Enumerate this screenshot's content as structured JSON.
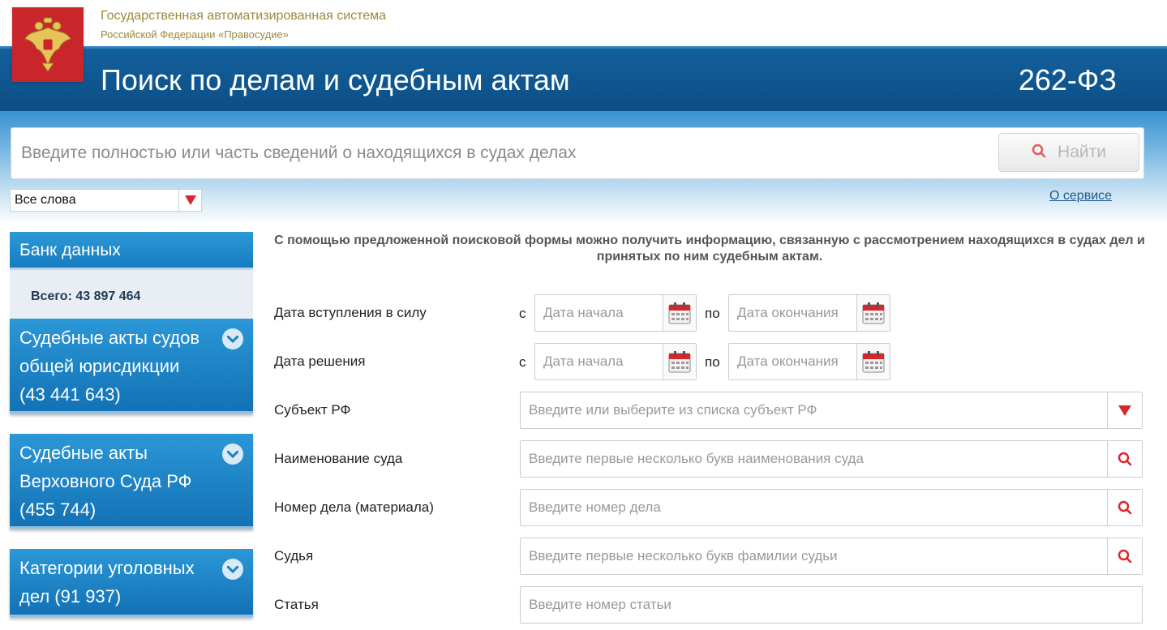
{
  "header": {
    "org_line1": "Государственная автоматизированная система",
    "org_line2": "Российской Федерации «Правосудие»",
    "title": "Поиск по делам и судебным актам",
    "law": "262-ФЗ",
    "emblem_icon": "coat-of-arms-icon"
  },
  "search": {
    "placeholder": "Введите полностью или часть сведений о находящихся в судах делах",
    "value": "",
    "button_label": "Найти",
    "mode_selected": "Все слова",
    "about_link": "О сервисе"
  },
  "sidebar": {
    "db_title": "Банк данных",
    "total_text": "Всего: 43 897 464",
    "cards": [
      {
        "lines": [
          "Судебные акты судов",
          "общей юрисдикции",
          "(43 441 643)"
        ]
      },
      {
        "lines": [
          "Судебные акты",
          "Верховного Суда РФ",
          "(455 744)"
        ]
      },
      {
        "lines": [
          "Категории уголовных",
          "дел (91 937)"
        ]
      }
    ]
  },
  "form": {
    "intro": "С помощью предложенной поисковой формы можно получить информацию, связанную с рассмотрением находящихся в судах дел и принятых по ним судебным актам.",
    "from_label": "с",
    "to_label": "по",
    "date_start_placeholder": "Дата начала",
    "date_end_placeholder": "Дата окончания",
    "rows": {
      "effective_date": "Дата вступления в силу",
      "decision_date": "Дата решения",
      "region": "Субъект РФ",
      "court": "Наименование суда",
      "case_number": "Номер дела (материала)",
      "judge": "Судья",
      "article": "Статья"
    },
    "placeholders": {
      "region": "Введите или выберите из списка субъект РФ",
      "court": "Введите первые несколько букв наименования суда",
      "case_number": "Введите номер дела",
      "judge": "Введите первые несколько букв фамилии судьи",
      "article": "Введите номер статьи"
    }
  },
  "colors": {
    "header_blue": "#0f568f",
    "accent_red": "#d9262b",
    "card_blue": "#1a82c4",
    "org_text": "#9a8a3a"
  }
}
